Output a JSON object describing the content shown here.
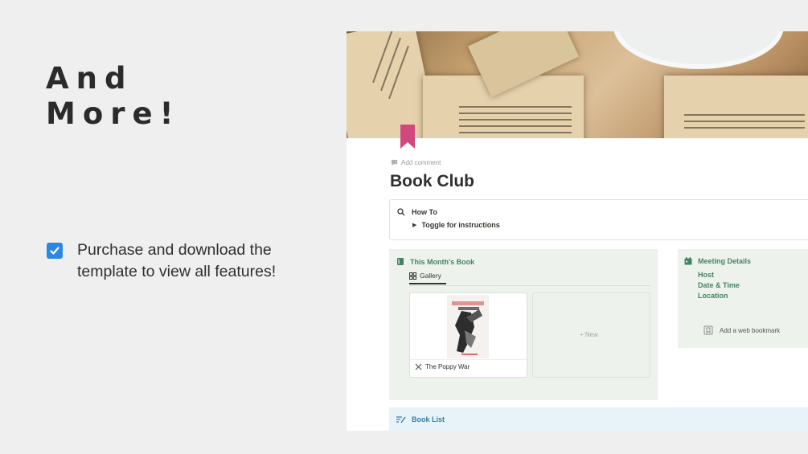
{
  "hero": {
    "line1": "And",
    "line2": "More!"
  },
  "feature": {
    "checked": true,
    "text": "Purchase and download the template to view all features!"
  },
  "notion": {
    "add_comment": "Add comment",
    "title": "Book Club",
    "howto": {
      "heading": "How To",
      "toggle": "Toggle for instructions"
    },
    "this_month": {
      "heading": "This Month's Book",
      "tab": "Gallery",
      "card_title": "The Poppy War",
      "new_label": "+ New"
    },
    "meeting": {
      "heading": "Meeting Details",
      "items": [
        "Host",
        "Date & Time",
        "Location"
      ],
      "bookmark": "Add a web bookmark"
    },
    "booklist": {
      "heading": "Book List"
    }
  },
  "colors": {
    "accent_blue": "#2b86e4",
    "green_text": "#448361",
    "green_bg": "#edf3ec",
    "blue_text": "#337ea9",
    "blue_bg": "#e7f3f8",
    "bookmark_pink": "#d1487f"
  }
}
